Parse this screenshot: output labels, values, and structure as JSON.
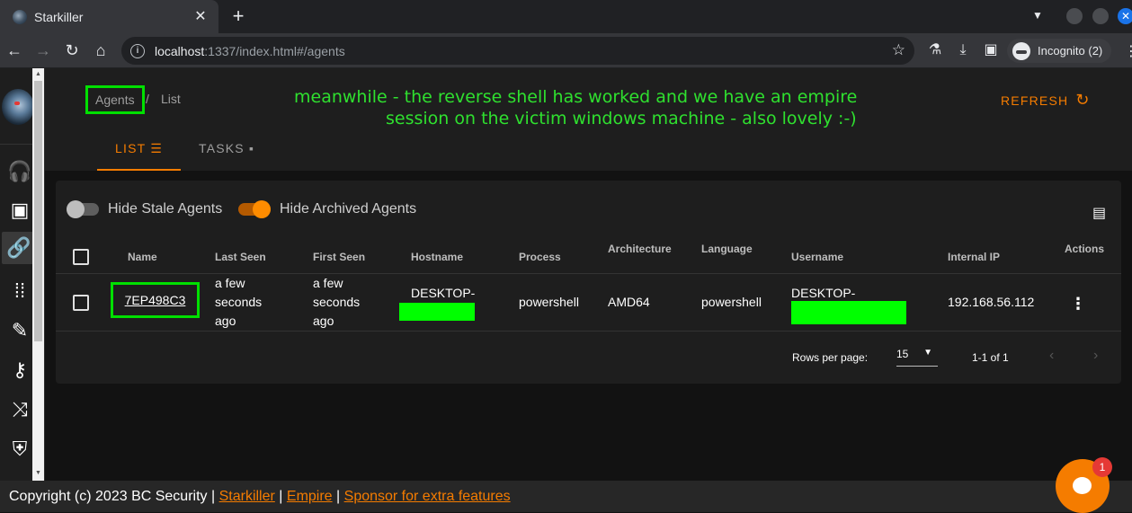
{
  "browser": {
    "tab_title": "Starkiller",
    "close_tab": "✕",
    "new_tab": "+",
    "url_host": "localhost",
    "url_rest": ":1337/index.html#/agents",
    "incognito_label": "Incognito (2)"
  },
  "breadcrumb": {
    "agents": "Agents",
    "separator": "/",
    "list": "List"
  },
  "annotation": {
    "line1": "meanwhile - the reverse shell has worked and we have an empire",
    "line2": "session on the victim windows machine - also lovely :-)"
  },
  "refresh_label": "REFRESH",
  "tabs": [
    {
      "label": "LIST"
    },
    {
      "label": "TASKS"
    }
  ],
  "filters": {
    "hide_stale": {
      "label": "Hide Stale Agents",
      "on": false
    },
    "hide_archived": {
      "label": "Hide Archived Agents",
      "on": true
    }
  },
  "table": {
    "headers": [
      "Name",
      "Last Seen",
      "First Seen",
      "Hostname",
      "Process",
      "Architecture",
      "Language",
      "Username",
      "Internal IP",
      "Actions"
    ],
    "rows": [
      {
        "name": "7EP498C3",
        "last_seen": [
          "a few",
          "seconds",
          "ago"
        ],
        "first_seen": [
          "a few",
          "seconds",
          "ago"
        ],
        "hostname": "DESKTOP-",
        "process": "powershell",
        "architecture": "AMD64",
        "language": "powershell",
        "username": "DESKTOP-",
        "internal_ip": "192.168.56.112"
      }
    ]
  },
  "pagination": {
    "rows_per_page_label": "Rows per page:",
    "rows_per_page": "15",
    "range": "1-1 of 1"
  },
  "footer": {
    "copyright": "Copyright (c) 2023 BC Security |",
    "link1": "Starkiller",
    "sep1": "|",
    "link2": "Empire",
    "sep2": "|",
    "link3": "Sponsor for extra features"
  },
  "chat": {
    "badge_count": "1"
  },
  "colors": {
    "accent": "#f57c00",
    "highlight": "#00e000",
    "background": "#121212",
    "surface": "#1e1e1e"
  }
}
